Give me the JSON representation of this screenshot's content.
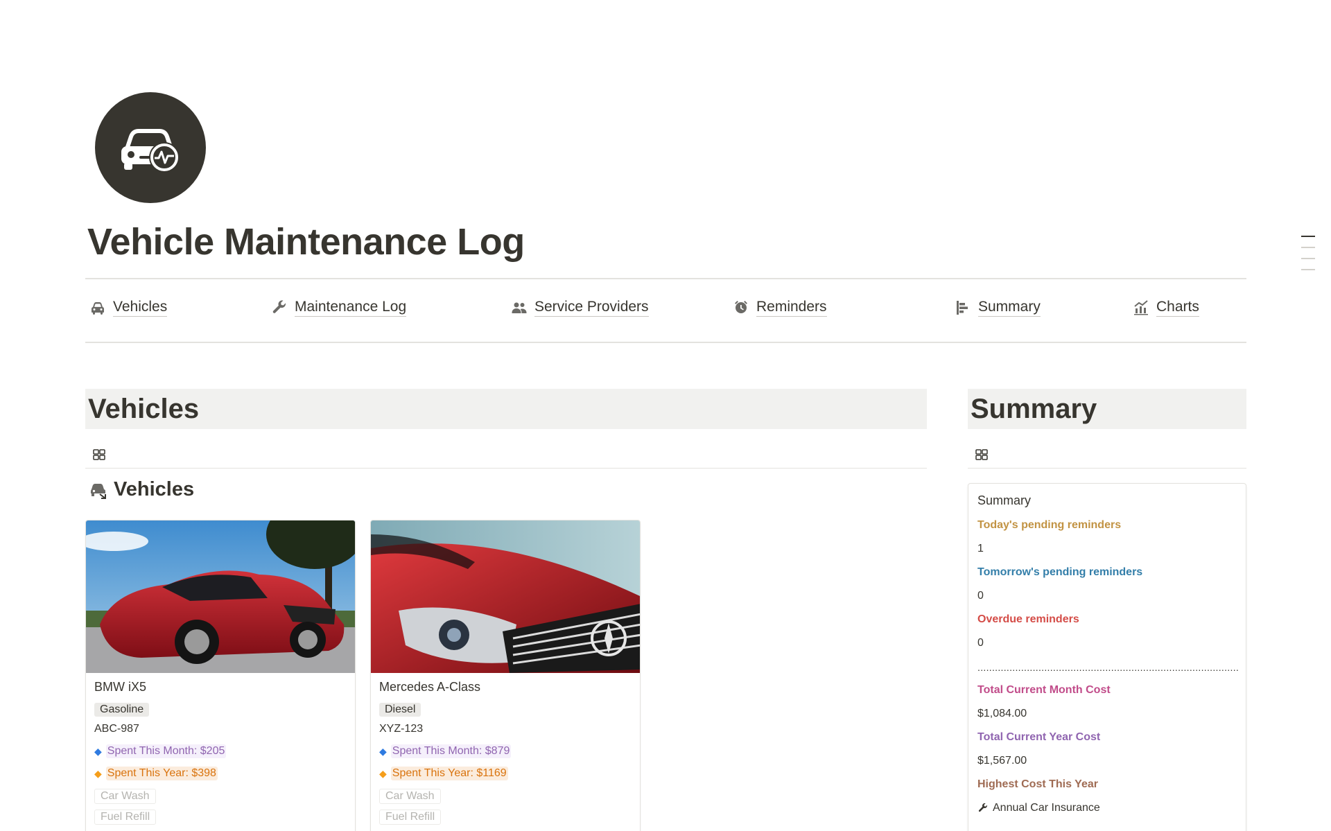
{
  "page": {
    "title": "Vehicle Maintenance Log"
  },
  "nav": [
    {
      "label": "Vehicles",
      "icon": "car-icon"
    },
    {
      "label": "Maintenance Log",
      "icon": "wrench-icon"
    },
    {
      "label": "Service Providers",
      "icon": "people-icon"
    },
    {
      "label": "Reminders",
      "icon": "alarm-icon"
    },
    {
      "label": "Summary",
      "icon": "summary-icon"
    },
    {
      "label": "Charts",
      "icon": "chart-icon"
    }
  ],
  "vehicles_section": {
    "heading": "Vehicles",
    "db_title": "Vehicles",
    "cards": [
      {
        "name": "BMW iX5",
        "fuel": "Gasoline",
        "plate": "ABC-987",
        "month": "Spent This Month: $205",
        "year": "Spent This Year: $398",
        "services": [
          "Car Wash",
          "Fuel Refill"
        ]
      },
      {
        "name": "Mercedes A-Class",
        "fuel": "Diesel",
        "plate": "XYZ-123",
        "month": "Spent This Month: $879",
        "year": "Spent This Year: $1169",
        "services": [
          "Car Wash",
          "Fuel Refill"
        ]
      }
    ]
  },
  "summary_section": {
    "heading": "Summary",
    "card_title": "Summary",
    "today_label": "Today's pending reminders",
    "today_value": "1",
    "tomorrow_label": "Tomorrow's pending reminders",
    "tomorrow_value": "0",
    "overdue_label": "Overdue reminders",
    "overdue_value": "0",
    "separator": "..........................................................................................",
    "month_cost_label": "Total Current Month Cost",
    "month_cost_value": "$1,084.00",
    "year_cost_label": "Total Current Year Cost",
    "year_cost_value": "$1,567.00",
    "highest_label": "Highest Cost This Year",
    "highest_item": "Annual Car Insurance"
  },
  "colors": {
    "month_stat": "#9065b0",
    "year_stat": "#d9730d",
    "today": "#c29343",
    "tomorrow": "#337ea9",
    "overdue": "#d44c47"
  }
}
